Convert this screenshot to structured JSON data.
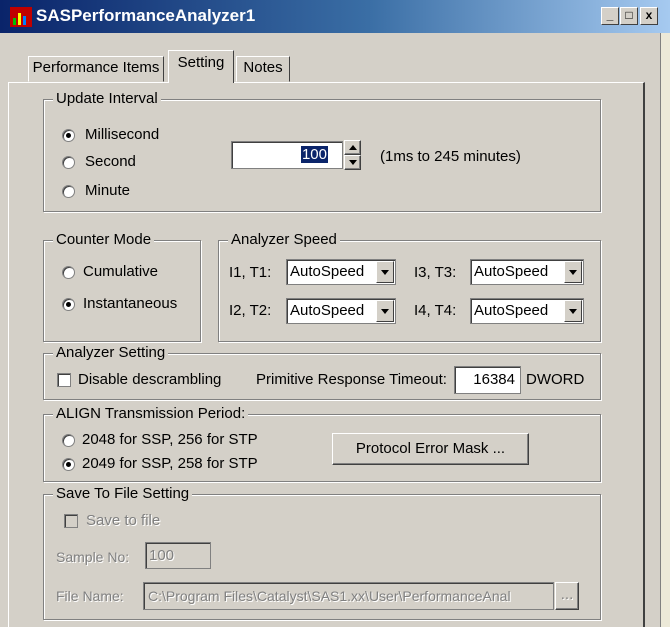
{
  "window": {
    "title": "SASPerformanceAnalyzer1",
    "minimize": "_",
    "maximize": "□",
    "close": "x"
  },
  "tabs": [
    {
      "label": "Performance Items"
    },
    {
      "label": "Setting"
    },
    {
      "label": "Notes"
    }
  ],
  "update_interval": {
    "legend": "Update Interval",
    "options": [
      {
        "label": "Millisecond",
        "selected": true
      },
      {
        "label": "Second",
        "selected": false
      },
      {
        "label": "Minute",
        "selected": false
      }
    ],
    "value": "100",
    "range_hint": "(1ms to 245 minutes)"
  },
  "counter_mode": {
    "legend": "Counter Mode",
    "options": [
      {
        "label": "Cumulative",
        "selected": false
      },
      {
        "label": "Instantaneous",
        "selected": true
      }
    ]
  },
  "analyzer_speed": {
    "legend": "Analyzer Speed",
    "rows": [
      {
        "label": "I1, T1:",
        "value": "AutoSpeed"
      },
      {
        "label": "I3, T3:",
        "value": "AutoSpeed"
      },
      {
        "label": "I2, T2:",
        "value": "AutoSpeed"
      },
      {
        "label": "I4, T4:",
        "value": "AutoSpeed"
      }
    ]
  },
  "analyzer_setting": {
    "legend": "Analyzer Setting",
    "disable_descrambling": "Disable descrambling",
    "timeout_label": "Primitive Response Timeout:",
    "timeout_value": "16384",
    "timeout_unit": "DWORD"
  },
  "align": {
    "legend": "ALIGN Transmission Period:",
    "options": [
      {
        "label": "2048 for SSP, 256 for STP",
        "selected": false
      },
      {
        "label": "2049 for SSP, 258 for STP",
        "selected": true
      }
    ],
    "protocol_button": "Protocol Error Mask ..."
  },
  "save_to_file": {
    "legend": "Save To File Setting",
    "save_label": "Save to file",
    "sample_label": "Sample No:",
    "sample_value": "100",
    "file_label": "File Name:",
    "file_value": "C:\\Program Files\\Catalyst\\SAS1.xx\\User\\PerformanceAnal",
    "browse_label": "..."
  }
}
